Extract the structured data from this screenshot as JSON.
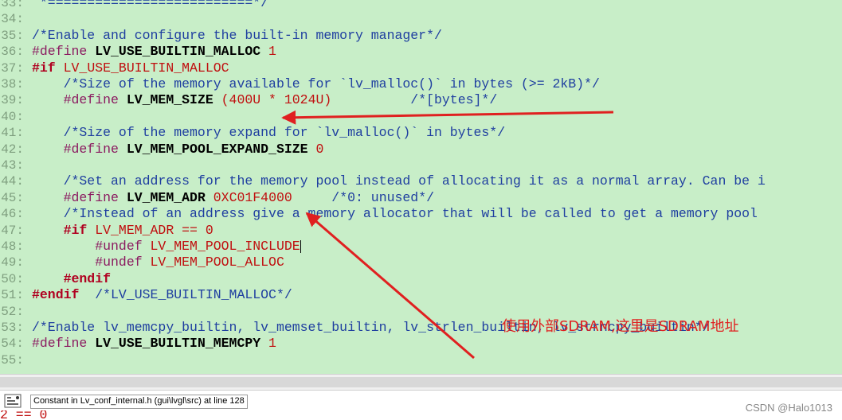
{
  "editor": {
    "lines": [
      {
        "no": "33:",
        "tokens": [
          {
            "t": " *==========================*/",
            "c": "c-comment"
          }
        ]
      },
      {
        "no": "34:",
        "tokens": []
      },
      {
        "no": "35:",
        "tokens": [
          {
            "t": "/*Enable and configure the built-in memory manager*/",
            "c": "c-comment"
          }
        ]
      },
      {
        "no": "36:",
        "tokens": [
          {
            "t": "#define ",
            "c": "c-kw"
          },
          {
            "t": "LV_USE_BUILTIN_MALLOC",
            "c": "c-name"
          },
          {
            "t": " 1",
            "c": "c-num"
          }
        ]
      },
      {
        "no": "37:",
        "tokens": [
          {
            "t": "#if ",
            "c": "c-kw-red"
          },
          {
            "t": "LV_USE_BUILTIN_MALLOC",
            "c": "c-mac"
          }
        ]
      },
      {
        "no": "38:",
        "tokens": [
          {
            "t": "    /*Size of the memory available for `lv_malloc()` in bytes (>= 2kB)*/",
            "c": "c-comment"
          }
        ]
      },
      {
        "no": "39:",
        "tokens": [
          {
            "t": "    #define ",
            "c": "c-kw"
          },
          {
            "t": "LV_MEM_SIZE",
            "c": "c-name"
          },
          {
            "t": " (400U * 1024U)",
            "c": "c-num"
          },
          {
            "t": "          /*[bytes]*/",
            "c": "c-comment"
          }
        ]
      },
      {
        "no": "40:",
        "tokens": []
      },
      {
        "no": "41:",
        "tokens": [
          {
            "t": "    /*Size of the memory expand for `lv_malloc()` in bytes*/",
            "c": "c-comment"
          }
        ]
      },
      {
        "no": "42:",
        "tokens": [
          {
            "t": "    #define ",
            "c": "c-kw"
          },
          {
            "t": "LV_MEM_POOL_EXPAND_SIZE",
            "c": "c-name"
          },
          {
            "t": " 0",
            "c": "c-num"
          }
        ]
      },
      {
        "no": "43:",
        "tokens": []
      },
      {
        "no": "44:",
        "tokens": [
          {
            "t": "    /*Set an address for the memory pool instead of allocating it as a normal array. Can be i",
            "c": "c-comment"
          }
        ]
      },
      {
        "no": "45:",
        "tokens": [
          {
            "t": "    #define ",
            "c": "c-kw"
          },
          {
            "t": "LV_MEM_ADR",
            "c": "c-name"
          },
          {
            "t": " 0XC01F4000",
            "c": "c-num"
          },
          {
            "t": "     /*0: unused*/",
            "c": "c-comment"
          }
        ]
      },
      {
        "no": "46:",
        "tokens": [
          {
            "t": "    /*Instead of an address give a memory allocator that will be called to get a memory pool",
            "c": "c-comment"
          }
        ]
      },
      {
        "no": "47:",
        "tokens": [
          {
            "t": "    #if ",
            "c": "c-kw-red"
          },
          {
            "t": "LV_MEM_ADR == 0",
            "c": "c-mac"
          }
        ]
      },
      {
        "no": "48:",
        "tokens": [
          {
            "t": "        #undef ",
            "c": "c-kw"
          },
          {
            "t": "LV_MEM_POOL_INCLUDE",
            "c": "c-mac"
          },
          {
            "t": "|",
            "c": "cursor"
          }
        ]
      },
      {
        "no": "49:",
        "tokens": [
          {
            "t": "        #undef ",
            "c": "c-kw"
          },
          {
            "t": "LV_MEM_POOL_ALLOC",
            "c": "c-mac"
          }
        ]
      },
      {
        "no": "50:",
        "tokens": [
          {
            "t": "    #endif",
            "c": "c-kw-red"
          }
        ]
      },
      {
        "no": "51:",
        "tokens": [
          {
            "t": "#endif",
            "c": "c-kw-red"
          },
          {
            "t": "  /*LV_USE_BUILTIN_MALLOC*/",
            "c": "c-comment"
          }
        ]
      },
      {
        "no": "52:",
        "tokens": []
      },
      {
        "no": "53:",
        "tokens": [
          {
            "t": "/*Enable lv_memcpy_builtin, lv_memset_builtin, lv_strlen_builtin, lv_strncpy_builtin*/",
            "c": "c-comment"
          }
        ]
      },
      {
        "no": "54:",
        "tokens": [
          {
            "t": "#define ",
            "c": "c-kw"
          },
          {
            "t": "LV_USE_BUILTIN_MEMCPY",
            "c": "c-name"
          },
          {
            "t": " 1",
            "c": "c-num"
          }
        ]
      },
      {
        "no": "55:",
        "tokens": []
      }
    ]
  },
  "annotation": {
    "text": "使用外部SDRAM,这里是SDRAM地址",
    "color": "#e02020"
  },
  "status": {
    "text": "Constant in Lv_conf_internal.h (gui\\lvgl\\src) at line 128",
    "icon": "symbol-browser-icon"
  },
  "bottom_code": {
    "text": "2 == 0"
  },
  "watermark": "CSDN @Halo1013",
  "colors": {
    "editor_bg": "#c8eec8",
    "comment": "#1f3fa0",
    "keyword": "#8b1a60",
    "number": "#c01010",
    "arrow": "#e02020"
  }
}
